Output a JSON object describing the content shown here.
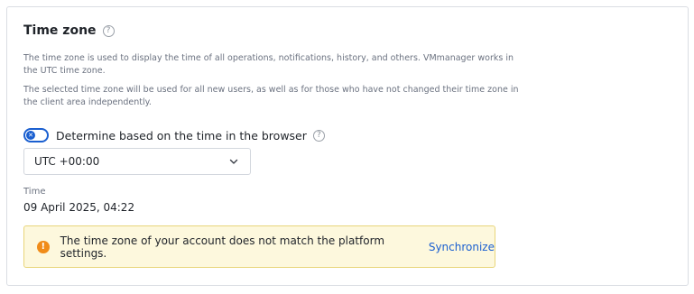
{
  "section": {
    "title": "Time zone",
    "help_icon": "question-circle-icon",
    "description_1": "The time zone is used to display the time of all operations, notifications, history, and others. VMmanager works in the UTC time zone.",
    "description_2": "The selected time zone will be used for all new users, as well as for those who have not changed their time zone in the client area independently."
  },
  "browser_toggle": {
    "label": "Determine based on the time in the browser",
    "state": "off",
    "knob_icon": "close-icon",
    "help_icon": "question-circle-icon"
  },
  "timezone_select": {
    "value": "UTC +00:00",
    "icon": "chevron-down-icon"
  },
  "time": {
    "label": "Time",
    "value": "09 April 2025, 04:22"
  },
  "alert": {
    "icon": "warning-icon",
    "message": "The time zone of your account does not match the platform settings.",
    "link_label": "Synchronize"
  },
  "colors": {
    "accent": "#1a5fd0",
    "alert_bg": "#fdf8dd",
    "alert_border": "#e8d57a",
    "warning": "#f08c1a"
  }
}
